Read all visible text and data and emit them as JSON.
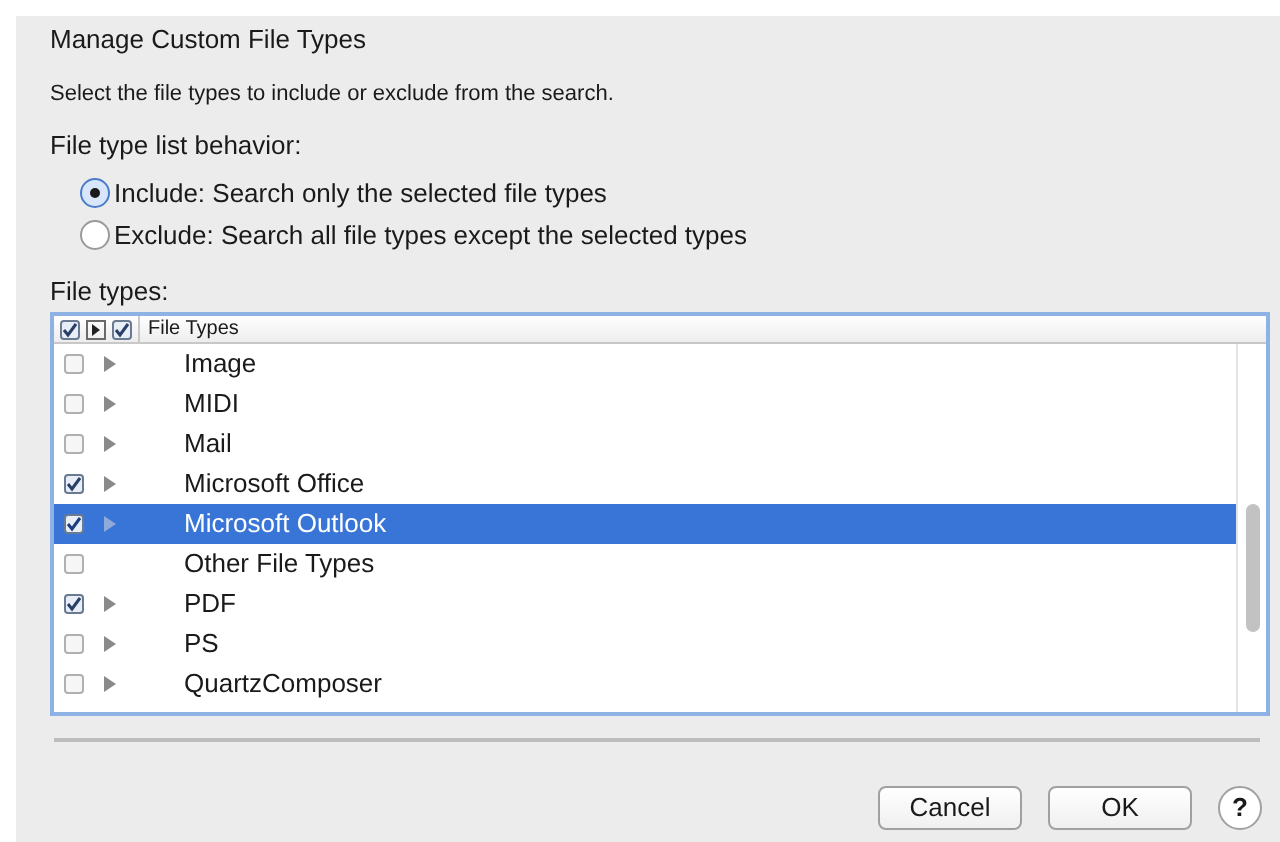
{
  "dialog": {
    "title": "Manage Custom File Types",
    "description": "Select the file types to include or exclude from the search."
  },
  "behavior": {
    "label": "File type list behavior:",
    "options": [
      {
        "label": "Include: Search only the selected file types",
        "selected": true
      },
      {
        "label": "Exclude: Search all file types except the selected types",
        "selected": false
      }
    ]
  },
  "file_types": {
    "label": "File types:",
    "header": {
      "all_checked": true,
      "expand_checked": true,
      "title": "File Types"
    },
    "rows": [
      {
        "label": "Image",
        "checked": false,
        "expandable": true,
        "selected": false
      },
      {
        "label": "MIDI",
        "checked": false,
        "expandable": true,
        "selected": false
      },
      {
        "label": "Mail",
        "checked": false,
        "expandable": true,
        "selected": false
      },
      {
        "label": "Microsoft Office",
        "checked": true,
        "expandable": true,
        "selected": false
      },
      {
        "label": "Microsoft Outlook",
        "checked": true,
        "expandable": true,
        "selected": true
      },
      {
        "label": "Other File Types",
        "checked": false,
        "expandable": false,
        "selected": false
      },
      {
        "label": "PDF",
        "checked": true,
        "expandable": true,
        "selected": false
      },
      {
        "label": "PS",
        "checked": false,
        "expandable": true,
        "selected": false
      },
      {
        "label": "QuartzComposer",
        "checked": false,
        "expandable": true,
        "selected": false
      }
    ]
  },
  "buttons": [
    {
      "label": "Cancel"
    },
    {
      "label": "OK"
    }
  ],
  "help": "?"
}
